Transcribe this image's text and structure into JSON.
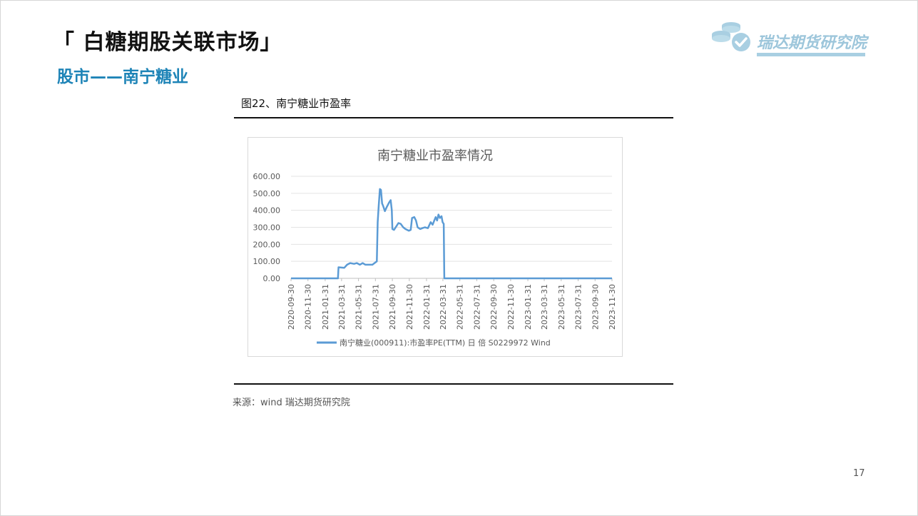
{
  "slide": {
    "title": "「 白糖期股关联市场」",
    "subtitle": "股市——南宁糖业",
    "logo_text": "瑞达期货研究院",
    "figure_caption": "图22、南宁糖业市盈率",
    "source": "来源：wind   瑞达期货研究院",
    "page_number": "17"
  },
  "colors": {
    "series": "#5b9bd5",
    "subtitle": "#1e84b7",
    "logo": "#9dc6db"
  },
  "chart_data": {
    "type": "line",
    "title": "南宁糖业市盈率情况",
    "ylim": [
      0,
      600
    ],
    "y_ticks": [
      "0.00",
      "100.00",
      "200.00",
      "300.00",
      "400.00",
      "500.00",
      "600.00"
    ],
    "x_ticks": [
      "2020-09-30",
      "2020-11-30",
      "2021-01-31",
      "2021-03-31",
      "2021-05-31",
      "2021-07-31",
      "2021-09-30",
      "2021-11-30",
      "2022-01-31",
      "2022-03-31",
      "2022-05-31",
      "2022-07-31",
      "2022-09-30",
      "2022-11-30",
      "2023-01-31",
      "2023-03-31",
      "2023-05-31",
      "2023-07-31",
      "2023-09-30",
      "2023-11-30"
    ],
    "x_range": [
      "2020-09-30",
      "2023-11-30"
    ],
    "grid": true,
    "legend": "bottom",
    "series": [
      {
        "name": "南宁糖业(000911):市盈率PE(TTM) 日 倍 S0229972 Wind",
        "points": [
          [
            "2020-09-30",
            0
          ],
          [
            "2021-03-18",
            0
          ],
          [
            "2021-03-20",
            65
          ],
          [
            "2021-04-10",
            62
          ],
          [
            "2021-04-20",
            80
          ],
          [
            "2021-05-01",
            90
          ],
          [
            "2021-05-15",
            85
          ],
          [
            "2021-05-25",
            90
          ],
          [
            "2021-06-05",
            80
          ],
          [
            "2021-06-15",
            90
          ],
          [
            "2021-06-25",
            80
          ],
          [
            "2021-07-20",
            80
          ],
          [
            "2021-08-01",
            95
          ],
          [
            "2021-08-05",
            100
          ],
          [
            "2021-08-08",
            330
          ],
          [
            "2021-08-12",
            430
          ],
          [
            "2021-08-16",
            525
          ],
          [
            "2021-08-20",
            520
          ],
          [
            "2021-08-24",
            440
          ],
          [
            "2021-08-28",
            425
          ],
          [
            "2021-09-03",
            395
          ],
          [
            "2021-09-10",
            420
          ],
          [
            "2021-09-18",
            445
          ],
          [
            "2021-09-24",
            460
          ],
          [
            "2021-09-28",
            400
          ],
          [
            "2021-09-30",
            290
          ],
          [
            "2021-10-06",
            285
          ],
          [
            "2021-10-14",
            305
          ],
          [
            "2021-10-22",
            325
          ],
          [
            "2021-10-30",
            320
          ],
          [
            "2021-11-08",
            300
          ],
          [
            "2021-11-16",
            290
          ],
          [
            "2021-11-28",
            280
          ],
          [
            "2021-12-05",
            285
          ],
          [
            "2021-12-10",
            355
          ],
          [
            "2021-12-18",
            360
          ],
          [
            "2021-12-24",
            340
          ],
          [
            "2021-12-30",
            300
          ],
          [
            "2022-01-08",
            290
          ],
          [
            "2022-01-16",
            295
          ],
          [
            "2022-01-25",
            300
          ],
          [
            "2022-02-05",
            295
          ],
          [
            "2022-02-15",
            330
          ],
          [
            "2022-02-22",
            315
          ],
          [
            "2022-03-01",
            345
          ],
          [
            "2022-03-05",
            360
          ],
          [
            "2022-03-10",
            340
          ],
          [
            "2022-03-15",
            375
          ],
          [
            "2022-03-20",
            355
          ],
          [
            "2022-03-26",
            365
          ],
          [
            "2022-03-30",
            330
          ],
          [
            "2022-04-03",
            320
          ],
          [
            "2022-04-05",
            0
          ],
          [
            "2023-11-30",
            0
          ]
        ]
      }
    ]
  }
}
